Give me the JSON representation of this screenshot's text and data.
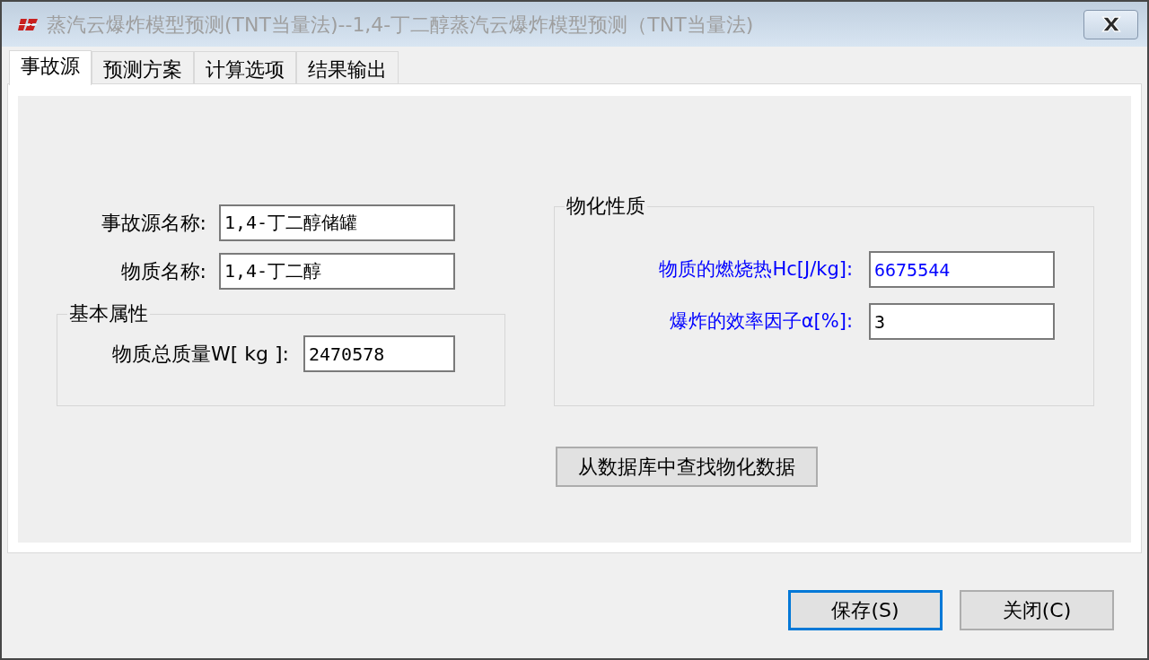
{
  "window": {
    "title": "蒸汽云爆炸模型预测(TNT当量法)--1,4-丁二醇蒸汽云爆炸模型预测（TNT当量法)"
  },
  "tabs": [
    {
      "label": "事故源",
      "selected": true
    },
    {
      "label": "预测方案",
      "selected": false
    },
    {
      "label": "计算选项",
      "selected": false
    },
    {
      "label": "结果输出",
      "selected": false
    }
  ],
  "source_fields": [
    {
      "label": "事故源名称:",
      "value": "1,4-丁二醇储罐"
    },
    {
      "label": "物质名称:",
      "value": "1,4-丁二醇"
    }
  ],
  "basic_properties": {
    "title": "基本属性",
    "fields": [
      {
        "label": "物质总质量W[ kg ]:",
        "value": "2470578"
      }
    ]
  },
  "physchem_properties": {
    "title": "物化性质",
    "fields": [
      {
        "label": "物质的燃烧热Hc[J/kg]:",
        "value": "6675544",
        "color": "#0000ff"
      },
      {
        "label": "爆炸的效率因子α[%]:",
        "value": "3",
        "color": "#000000"
      }
    ]
  },
  "lookup_button": {
    "label": "从数据库中查找物化数据"
  },
  "buttons": [
    {
      "label": "保存(S)",
      "focused": true
    },
    {
      "label": "关闭(C)",
      "focused": false
    }
  ]
}
